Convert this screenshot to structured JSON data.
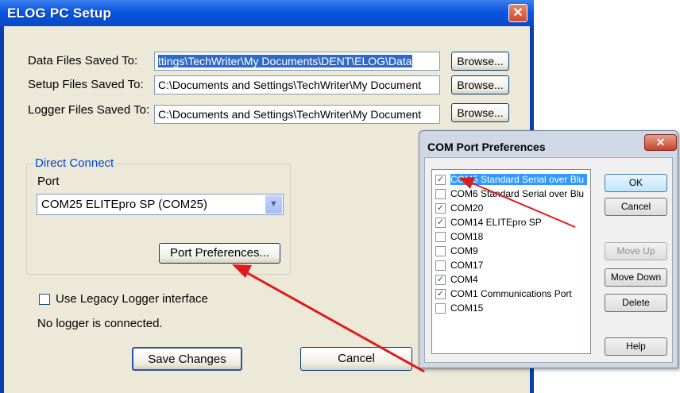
{
  "main_dialog": {
    "title": "ELOG PC Setup",
    "close_icon": "close-icon",
    "fields": [
      {
        "label": "Data Files Saved To:",
        "value": "ttings\\TechWriter\\My Documents\\DENT\\ELOG\\Data",
        "button": "Browse..."
      },
      {
        "label": "Setup Files Saved To:",
        "value": "C:\\Documents and Settings\\TechWriter\\My Document",
        "button": "Browse..."
      },
      {
        "label": "Logger Files Saved To:",
        "value": "C:\\Documents and Settings\\TechWriter\\My Document",
        "button": "Browse..."
      }
    ],
    "direct_connect": {
      "caption": "Direct Connect",
      "port_label": "Port",
      "port_value": "COM25 ELITEpro SP (COM25)",
      "port_preferences_button": "Port Preferences..."
    },
    "legacy_checkbox_label": "Use Legacy Logger interface",
    "status_text": "No logger is connected.",
    "save_button": "Save Changes",
    "cancel_button": "Cancel"
  },
  "com_port_dialog": {
    "title": "COM Port Preferences",
    "close_icon": "close-icon",
    "ports": [
      {
        "name": "COM5 Standard Serial over Blu",
        "checked": true,
        "selected": true
      },
      {
        "name": "COM6 Standard Serial over Blu",
        "checked": false,
        "selected": false
      },
      {
        "name": "COM20",
        "checked": true,
        "selected": false
      },
      {
        "name": "COM14 ELITEpro SP",
        "checked": true,
        "selected": false
      },
      {
        "name": "COM18",
        "checked": false,
        "selected": false
      },
      {
        "name": "COM9",
        "checked": false,
        "selected": false
      },
      {
        "name": "COM17",
        "checked": false,
        "selected": false
      },
      {
        "name": "COM4",
        "checked": true,
        "selected": false
      },
      {
        "name": "COM1 Communications Port",
        "checked": true,
        "selected": false
      },
      {
        "name": "COM15",
        "checked": false,
        "selected": false
      }
    ],
    "buttons": {
      "ok": "OK",
      "cancel": "Cancel",
      "move_up": "Move Up",
      "move_down": "Move Down",
      "delete": "Delete",
      "help": "Help"
    }
  },
  "colors": {
    "annotation_arrow": "#e0191b",
    "title_bar": "#0a57de",
    "group_caption": "#0046d5"
  }
}
